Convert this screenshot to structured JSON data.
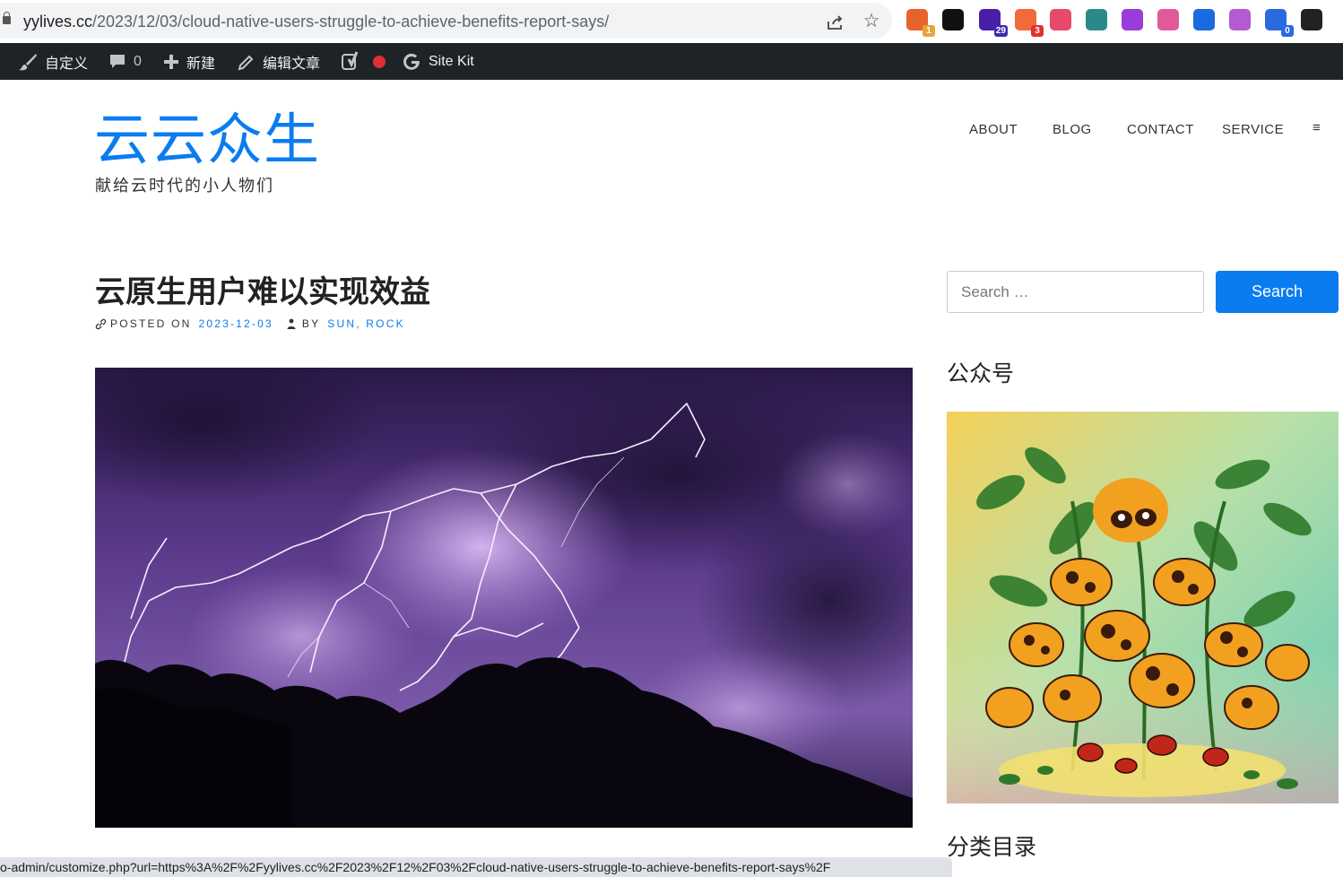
{
  "browser": {
    "url_host": "yylives.cc",
    "url_path": "/2023/12/03/cloud-native-users-struggle-to-achieve-benefits-report-says/",
    "extensions": [
      {
        "icon": "colorful-circle-ext-icon",
        "color": "#e8632b",
        "badge": "1",
        "badge_color": "#e8a33b"
      },
      {
        "icon": "notion-icon",
        "color": "#111111",
        "badge": ""
      },
      {
        "icon": "graduation-cap-icon",
        "color": "#4a1fa8",
        "badge": "29",
        "badge_color": "#3d2bb0"
      },
      {
        "icon": "orange-bubbles-icon",
        "color": "#f06a3a",
        "badge": "3",
        "badge_color": "#e03030"
      },
      {
        "icon": "translate-icon",
        "color": "#e84a6b",
        "badge": ""
      },
      {
        "icon": "circuit-icon",
        "color": "#2a8a8a",
        "badge": ""
      },
      {
        "icon": "purple-circle-icon",
        "color": "#9b3bd9",
        "badge": ""
      },
      {
        "icon": "cloud-outline-icon",
        "color": "#e05a9a",
        "badge": ""
      },
      {
        "icon": "blue-arrow-icon",
        "color": "#1a6ae0",
        "badge": ""
      },
      {
        "icon": "openai-icon",
        "color": "#b55ad0",
        "badge": ""
      },
      {
        "icon": "sync-icon",
        "color": "#2a6ae0",
        "badge": "0",
        "badge_color": "#2a6ae0"
      },
      {
        "icon": "h-logo-icon",
        "color": "#222222",
        "badge": ""
      }
    ]
  },
  "adminbar": {
    "customize": "自定义",
    "comments_count": "0",
    "new": "新建",
    "edit": "编辑文章",
    "sitekit": "Site Kit"
  },
  "site": {
    "title": "云云众生",
    "description": "献给云时代的小人物们"
  },
  "nav": {
    "items": [
      "ABOUT",
      "BLOG",
      "CONTACT",
      "SERVICE"
    ],
    "menu_icon": "≡"
  },
  "post": {
    "title": "云原生用户难以实现效益",
    "posted_on_label": "POSTED ON",
    "date": "2023-12-03",
    "by_label": "BY",
    "author": "SUN, ROCK"
  },
  "sidebar": {
    "search_placeholder": "Search …",
    "search_button": "Search",
    "widget1_title": "公众号",
    "widget2_title": "分类目录"
  },
  "statusbar": {
    "text": "o-admin/customize.php?url=https%3A%2F%2Fyylives.cc%2F2023%2F12%2F03%2Fcloud-native-users-struggle-to-achieve-benefits-report-says%2F"
  }
}
